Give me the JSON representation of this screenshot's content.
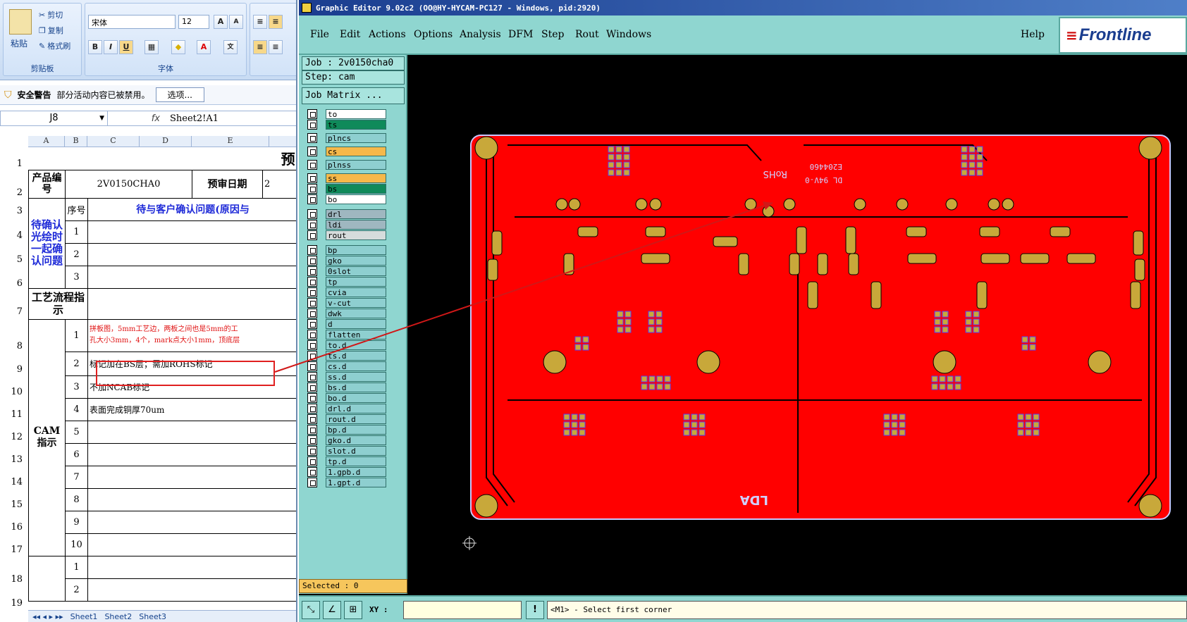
{
  "excel": {
    "clipboard": {
      "paste": "粘贴",
      "cut": "剪切",
      "copy": "复制",
      "format_painter": "格式刷",
      "caption": "剪贴板"
    },
    "font": {
      "name": "宋体",
      "size": "12",
      "bold": "B",
      "italic": "I",
      "underline": "U",
      "caption": "字体"
    },
    "security": {
      "label": "安全警告",
      "message": "部分活动内容已被禁用。",
      "options": "选项..."
    },
    "formula_bar": {
      "name_box": "J8",
      "fx": "fx",
      "formula": "Sheet2!A1"
    },
    "columns": [
      "A",
      "B",
      "C",
      "D",
      "E"
    ],
    "rows": [
      "1",
      "2",
      "3",
      "4",
      "5",
      "6",
      "7",
      "8",
      "9",
      "10",
      "11",
      "12",
      "13",
      "14",
      "15",
      "16",
      "17",
      "18",
      "19"
    ],
    "cells": {
      "title_partial": "预",
      "product_code_label": "产品编号",
      "product_code": "2V0150CHA0",
      "review_date_label": "预审日期",
      "review_date_partial": "2",
      "seq_label": "序号",
      "confirm_header": "待与客户确认问题(原因与",
      "confirm_label": "待确认光绘时一起确认问题",
      "process_label": "工艺流程指示",
      "cam_label": "CAM指示",
      "item1_line1": "拼板图，5mm工艺边，两板之间也是5mm的工",
      "item1_line2": "孔大小3mm，4个，mark点大小1mm，顶底层",
      "item2": "标记加在BS层；需加ROHS标记",
      "item3": "不加NCAB标记",
      "item4": "表面完成铜厚70um",
      "numbers": [
        "1",
        "2",
        "3",
        "1",
        "2",
        "3",
        "4",
        "5",
        "6",
        "7",
        "8",
        "9",
        "10",
        "1",
        "2"
      ]
    },
    "sheet_tabs": [
      "Sheet1",
      "Sheet2",
      "Sheet3"
    ]
  },
  "genesis": {
    "title": "Graphic Editor 9.02c2 (OO@HY-HYCAM-PC127 - Windows, pid:2920)",
    "menu": [
      "File",
      "Edit",
      "Actions",
      "Options",
      "Analysis",
      "DFM",
      "Step",
      "Rout",
      "Windows",
      "Help"
    ],
    "logo": "Frontline",
    "job": "Job : 2v0150cha0",
    "step": "Step: cam",
    "job_matrix": "Job Matrix ...",
    "layers": [
      {
        "name": "to",
        "color": "#ffffff"
      },
      {
        "name": "ts",
        "color": "#0f8a5a"
      },
      {
        "name": "plncs",
        "color": "#8ecfd0"
      },
      {
        "name": "cs",
        "color": "#f6b84a"
      },
      {
        "name": "plnss",
        "color": "#8ecfd0"
      },
      {
        "name": "ss",
        "color": "#f6b84a"
      },
      {
        "name": "bs",
        "color": "#0f8a5a"
      },
      {
        "name": "bo",
        "color": "#ffffff"
      },
      {
        "name": "drl",
        "color": "#9fb7c0"
      },
      {
        "name": "ldi",
        "color": "#9fb7c0"
      },
      {
        "name": "rout",
        "color": "#d6dcdc"
      },
      {
        "name": "bp",
        "color": "#8ecfd0"
      },
      {
        "name": "gko",
        "color": "#8ecfd0"
      },
      {
        "name": "0slot",
        "color": "#8ecfd0"
      },
      {
        "name": "tp",
        "color": "#8ecfd0"
      },
      {
        "name": "cvia",
        "color": "#8ecfd0"
      },
      {
        "name": "v-cut",
        "color": "#8ecfd0"
      },
      {
        "name": "dwk",
        "color": "#8ecfd0"
      },
      {
        "name": "d",
        "color": "#8ecfd0"
      },
      {
        "name": "flatten",
        "color": "#8ecfd0"
      },
      {
        "name": "to.d",
        "color": "#8ecfd0"
      },
      {
        "name": "ts.d",
        "color": "#8ecfd0"
      },
      {
        "name": "cs.d",
        "color": "#8ecfd0"
      },
      {
        "name": "ss.d",
        "color": "#8ecfd0"
      },
      {
        "name": "bs.d",
        "color": "#8ecfd0"
      },
      {
        "name": "bo.d",
        "color": "#8ecfd0"
      },
      {
        "name": "drl.d",
        "color": "#8ecfd0"
      },
      {
        "name": "rout.d",
        "color": "#8ecfd0"
      },
      {
        "name": "bp.d",
        "color": "#8ecfd0"
      },
      {
        "name": "gko.d",
        "color": "#8ecfd0"
      },
      {
        "name": "slot.d",
        "color": "#8ecfd0"
      },
      {
        "name": "tp.d",
        "color": "#8ecfd0"
      },
      {
        "name": "1.gpb.d",
        "color": "#8ecfd0"
      },
      {
        "name": "1.gpt.d",
        "color": "#8ecfd0"
      }
    ],
    "selected": "Selected : 0",
    "xy_label": "XY :",
    "status": "<M1> - Select first corner",
    "board_text": {
      "rohs": "RoHS",
      "code": "E204460",
      "dl": "DL 94V-0",
      "lda": "LDA"
    },
    "colors": {
      "board": "#ff0000",
      "pad": "#c8a83a",
      "ui": "#8fd6d0"
    }
  }
}
